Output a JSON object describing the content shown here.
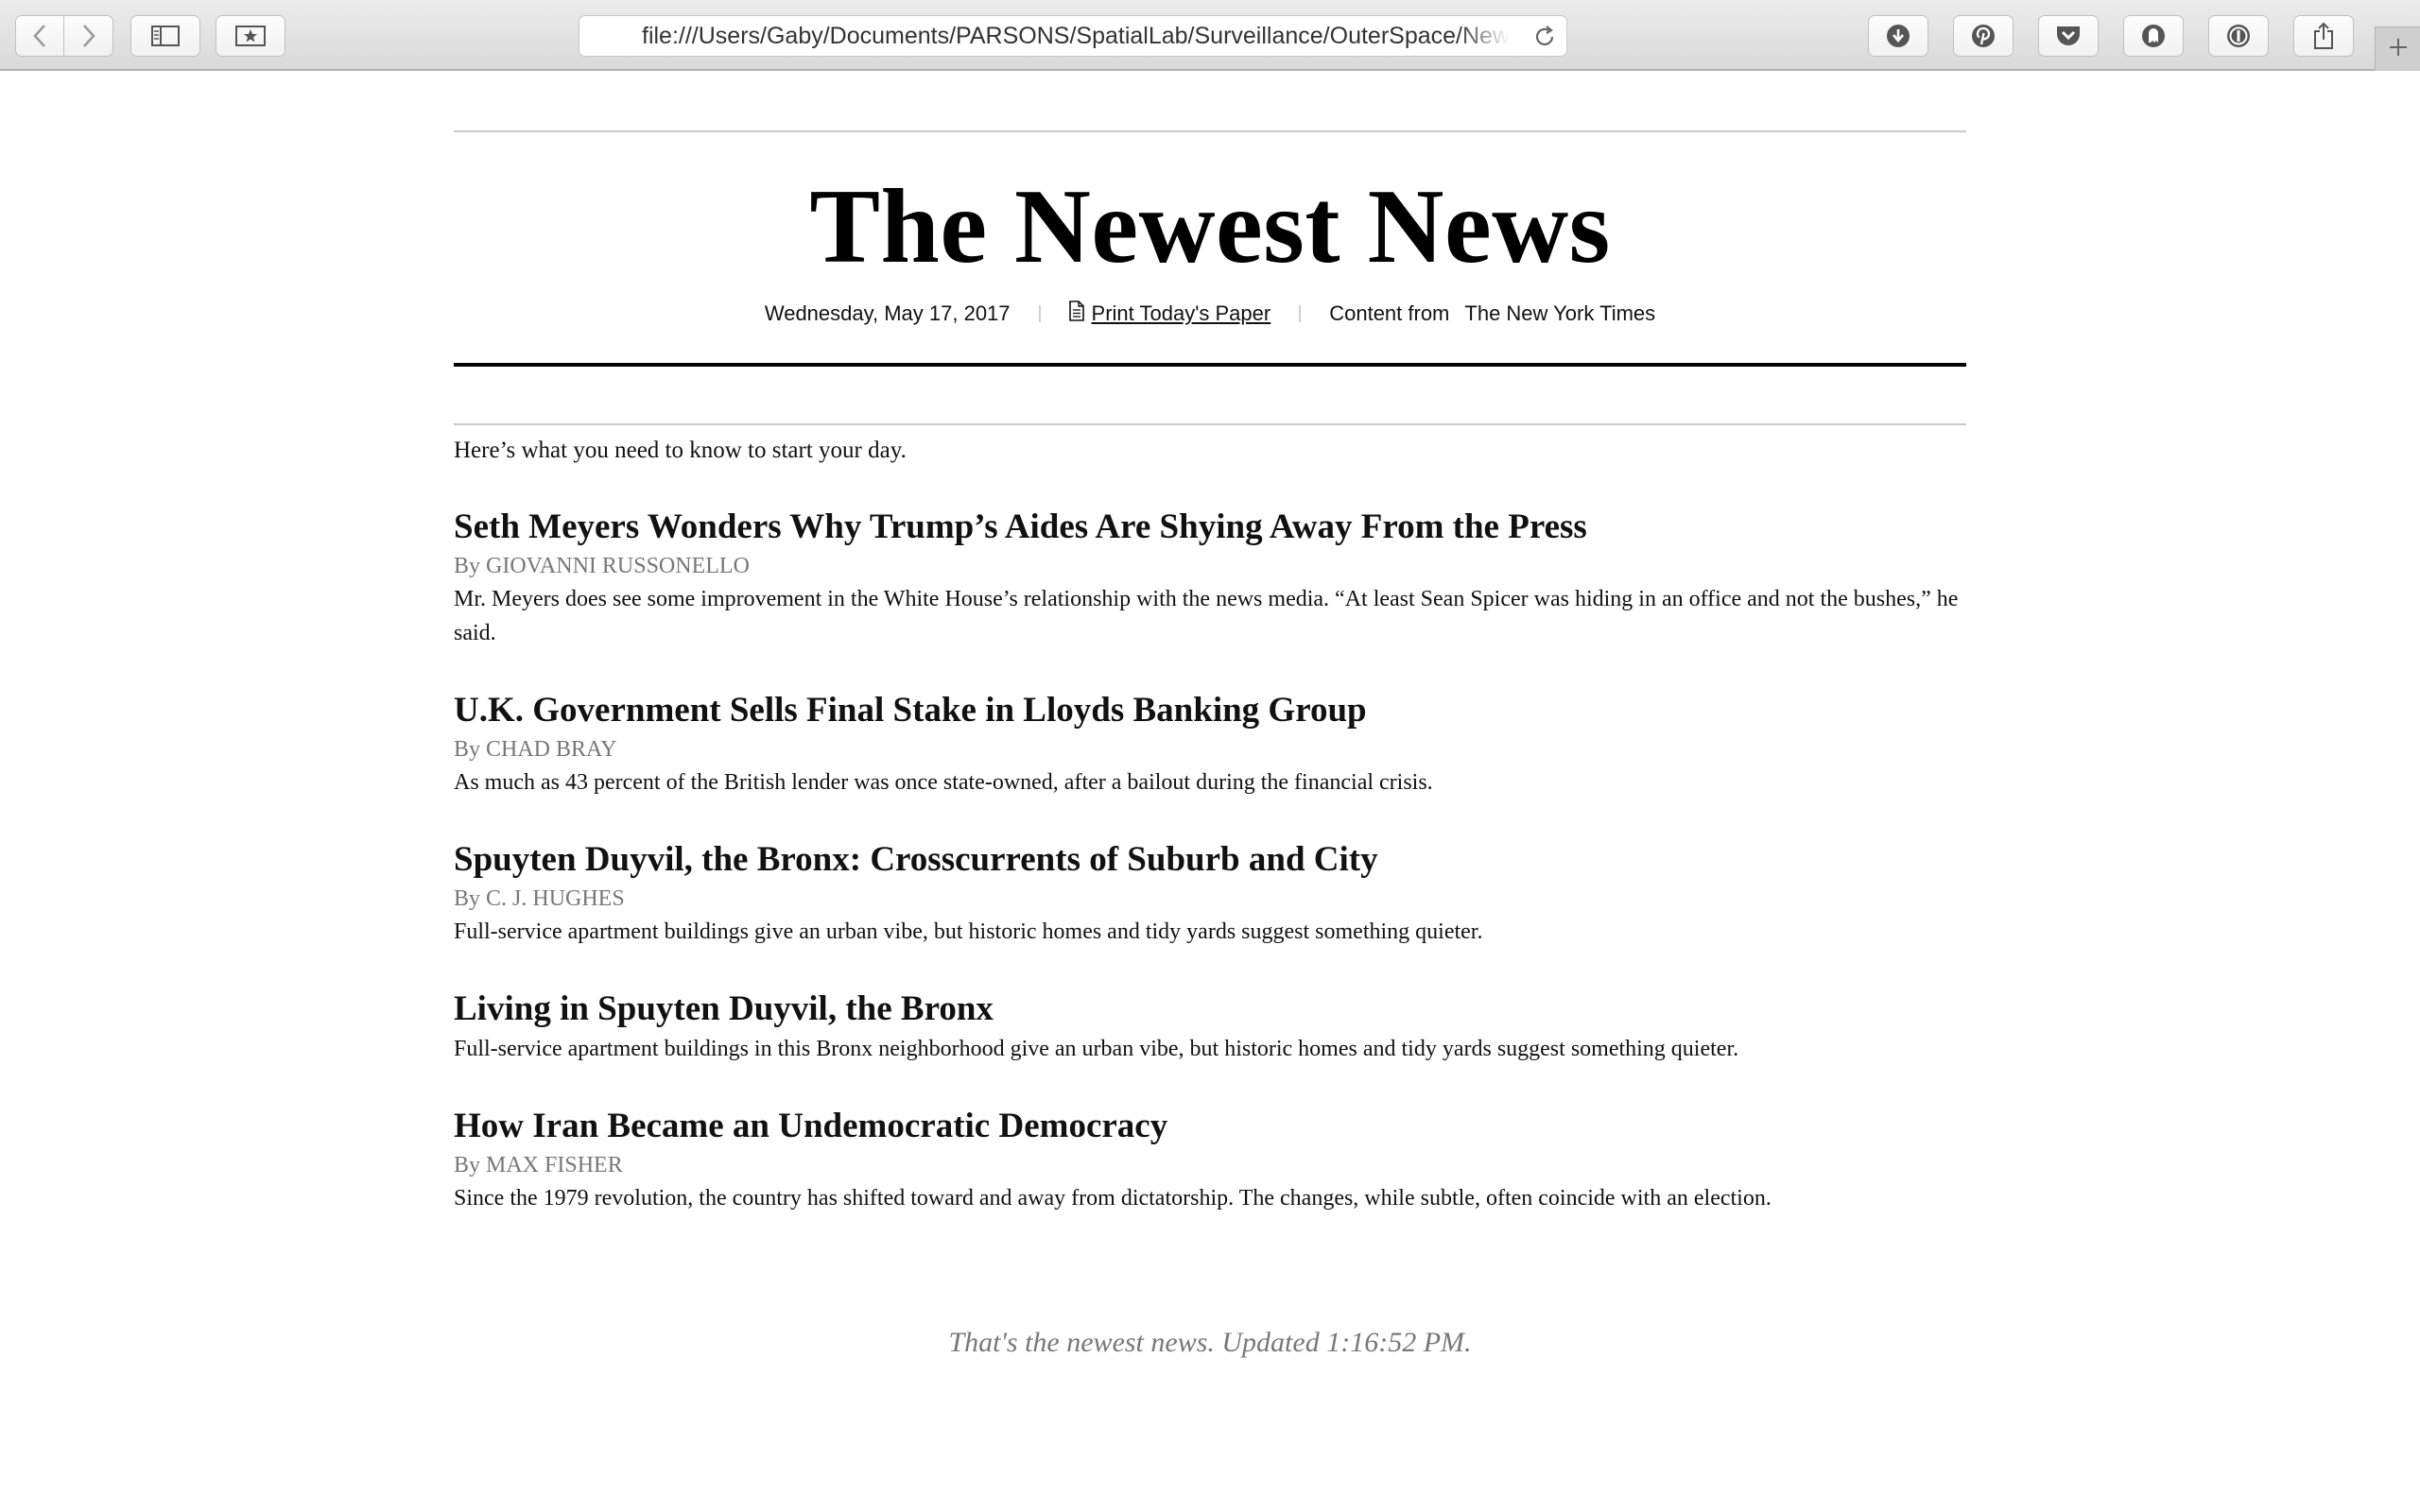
{
  "browser": {
    "url": "file:///Users/Gaby/Documents/PARSONS/SpatialLab/Surveillance/OuterSpace/NewestNews",
    "toolbar_icons": [
      "back-icon",
      "forward-icon",
      "sidebar-icon",
      "bookmarks-icon",
      "reload-icon"
    ],
    "extension_icons": [
      "download-icon",
      "pinterest-icon",
      "pocket-icon",
      "ghostery-icon",
      "onepassword-icon",
      "share-icon"
    ],
    "new_tab_icon": "plus-icon"
  },
  "masthead": {
    "title": "The Newest News",
    "date": "Wednesday, May 17, 2017",
    "print_link": "Print Today's Paper",
    "content_from_label": "Content from",
    "source_name": "The New York Times"
  },
  "intro": "Here’s what you need to know to start your day.",
  "articles": [
    {
      "headline": "Seth Meyers Wonders Why Trump’s Aides Are Shying Away From the Press",
      "byline": "By GIOVANNI RUSSONELLO",
      "summary": "Mr. Meyers does see some improvement in the White House’s relationship with the news media. “At least Sean Spicer was hiding in an office and not the bushes,” he said."
    },
    {
      "headline": "U.K. Government Sells Final Stake in Lloyds Banking Group",
      "byline": "By CHAD BRAY",
      "summary": "As much as 43 percent of the British lender was once state-owned, after a bailout during the financial crisis."
    },
    {
      "headline": "Spuyten Duyvil, the Bronx: Crosscurrents of Suburb and City",
      "byline": "By C. J. HUGHES",
      "summary": "Full-service apartment buildings give an urban vibe, but historic homes and tidy yards suggest something quieter."
    },
    {
      "headline": "Living in Spuyten Duyvil, the Bronx",
      "byline": "",
      "summary": "Full-service apartment buildings in this Bronx neighborhood give an urban vibe, but historic homes and tidy yards suggest something quieter."
    },
    {
      "headline": "How Iran Became an Undemocratic Democracy",
      "byline": "By MAX FISHER",
      "summary": "Since the 1979 revolution, the country has shifted toward and away from dictatorship. The changes, while subtle, often coincide with an election."
    }
  ],
  "footer": "That's the newest news. Updated 1:16:52 PM.",
  "colors": {
    "text": "#111111",
    "byline": "#777777",
    "rule": "#c9c9c9",
    "chrome_bg": "#e3e3e3",
    "icon": "#555555"
  }
}
